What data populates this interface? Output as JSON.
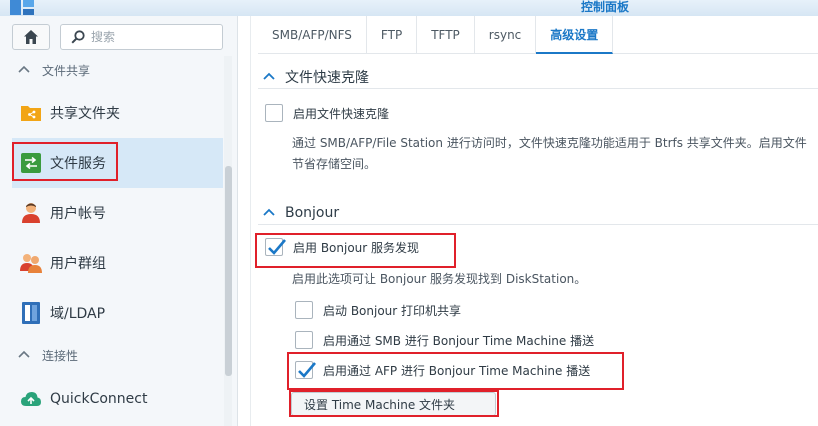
{
  "window": {
    "title": "控制面板"
  },
  "sidebar": {
    "search_placeholder": "搜索",
    "groups": [
      {
        "label": "文件共享"
      },
      {
        "label": "连接性"
      }
    ],
    "items": [
      {
        "label": "共享文件夹"
      },
      {
        "label": "文件服务"
      },
      {
        "label": "用户帐号"
      },
      {
        "label": "用户群组"
      },
      {
        "label": "域/LDAP"
      },
      {
        "label": "QuickConnect"
      }
    ]
  },
  "tabs": [
    {
      "label": "SMB/AFP/NFS"
    },
    {
      "label": "FTP"
    },
    {
      "label": "TFTP"
    },
    {
      "label": "rsync"
    },
    {
      "label": "高级设置"
    }
  ],
  "clone": {
    "title": "文件快速克隆",
    "enable_label": "启用文件快速克隆",
    "desc_line1": "通过 SMB/AFP/File Station 进行访问时，文件快速克隆功能适用于 Btrfs 共享文件夹。启用文件",
    "desc_line2": "节省存储空间。"
  },
  "bonjour": {
    "title": "Bonjour",
    "enable_label": "启用 Bonjour 服务发现",
    "desc": "启用此选项可让 Bonjour 服务发现找到 DiskStation。",
    "printer_label": "启动 Bonjour 打印机共享",
    "smb_tm_label": "启用通过 SMB 进行 Bonjour Time Machine 播送",
    "afp_tm_label": "启用通过 AFP 进行 Bonjour Time Machine 播送",
    "tm_button": "设置 Time Machine 文件夹"
  },
  "state": {
    "clone_enabled": false,
    "bonjour_enabled": true,
    "printer_sharing": false,
    "smb_time_machine": false,
    "afp_time_machine": true
  },
  "colors": {
    "accent": "#1b78c7",
    "highlight_box": "#e0202a",
    "active_item_bg": "#d6e8f7"
  }
}
